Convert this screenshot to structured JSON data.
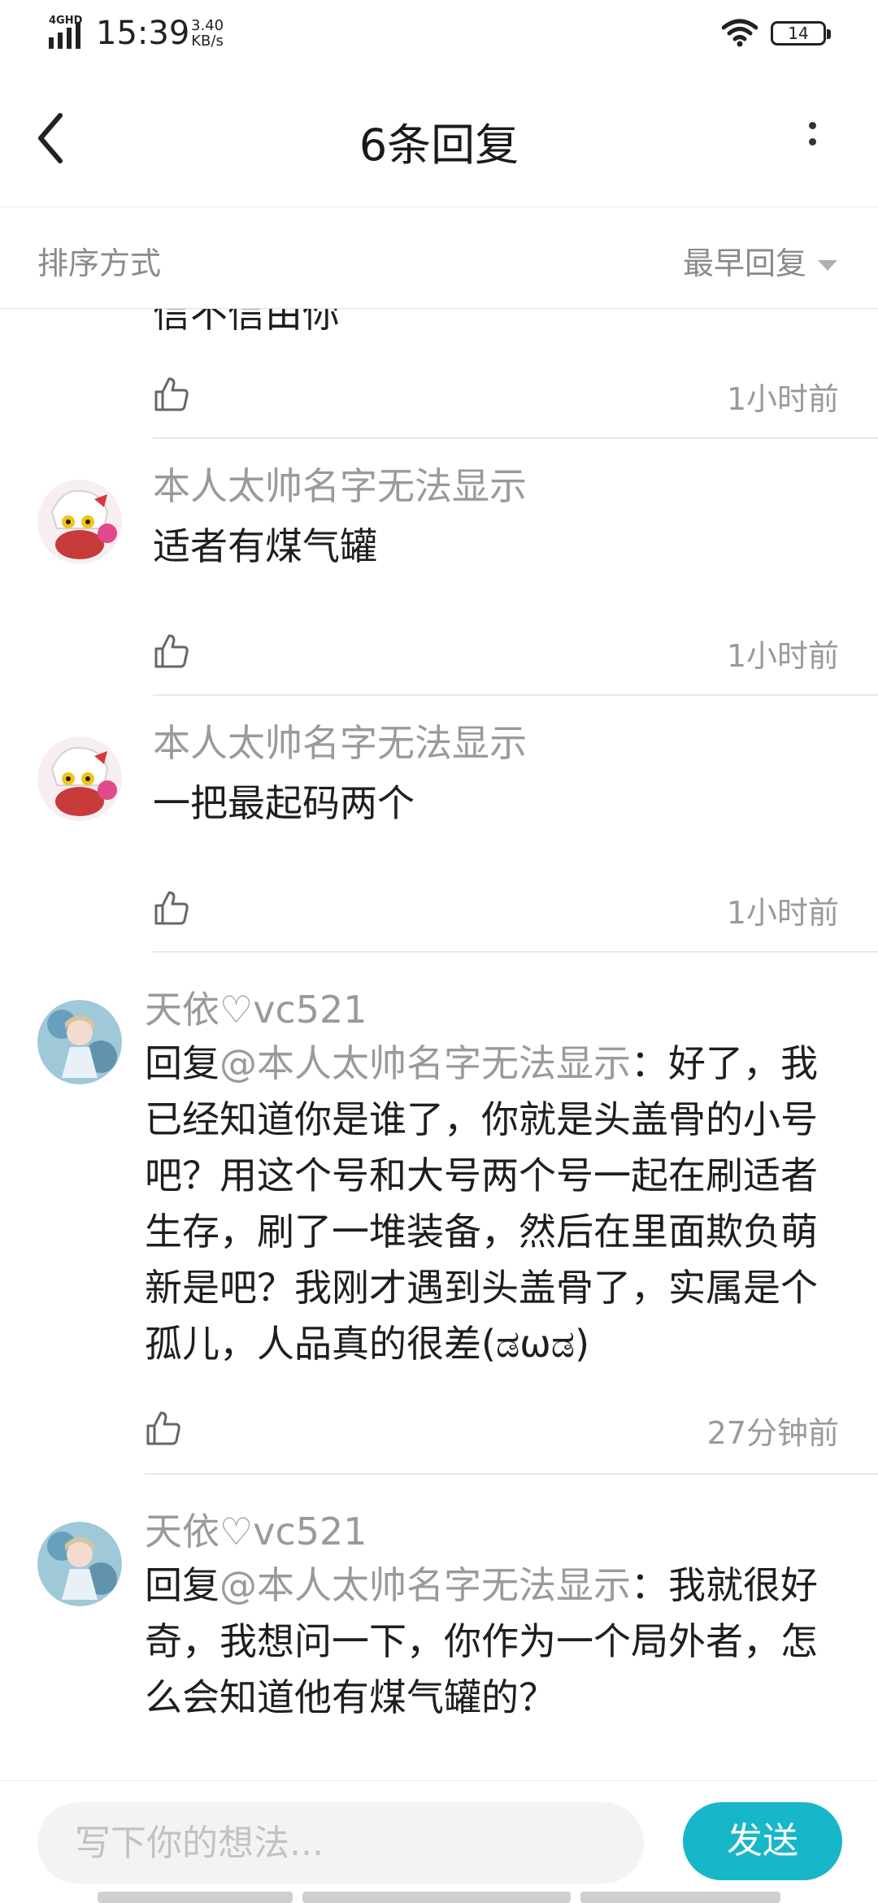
{
  "status_bar": {
    "network": "4GHD",
    "time": "15:39",
    "speed_value": "3.40",
    "speed_unit": "KB/s",
    "battery": "14"
  },
  "header": {
    "title": "6条回复"
  },
  "sort": {
    "label": "排序方式",
    "selected": "最早回复"
  },
  "replies": [
    {
      "username": "",
      "content": "信不信由你",
      "time": "1小时前"
    },
    {
      "username": "本人太帅名字无法显示",
      "content": "适者有煤气罐",
      "time": "1小时前"
    },
    {
      "username": "本人太帅名字无法显示",
      "content": "一把最起码两个",
      "time": "1小时前"
    },
    {
      "username": "天依♡vc521",
      "reply_prefix": "回复",
      "mention": "@本人太帅名字无法显示",
      "content": "：好了，我已经知道你是谁了，你就是头盖骨的小号吧？用这个号和大号两个号一起在刷适者生存，刷了一堆装备，然后在里面欺负萌新是吧？我刚才遇到头盖骨了，实属是个孤儿，人品真的很差(ಡωಡ)",
      "time": "27分钟前"
    },
    {
      "username": "天依♡vc521",
      "reply_prefix": "回复",
      "mention": "@本人太帅名字无法显示",
      "content": "：我就很好奇，我想问一下，你作为一个局外者，怎么会知道他有煤气罐的？",
      "time": ""
    }
  ],
  "composer": {
    "placeholder": "写下你的想法...",
    "send_label": "发送"
  },
  "colors": {
    "accent": "#17b6c8",
    "muted_text": "#9a9a9a",
    "divider": "#e8e8e8"
  },
  "icons": [
    "signal-icon",
    "wifi-icon",
    "battery-icon",
    "back-icon",
    "more-icon",
    "thumbs-up-icon",
    "dropdown-caret-icon"
  ]
}
